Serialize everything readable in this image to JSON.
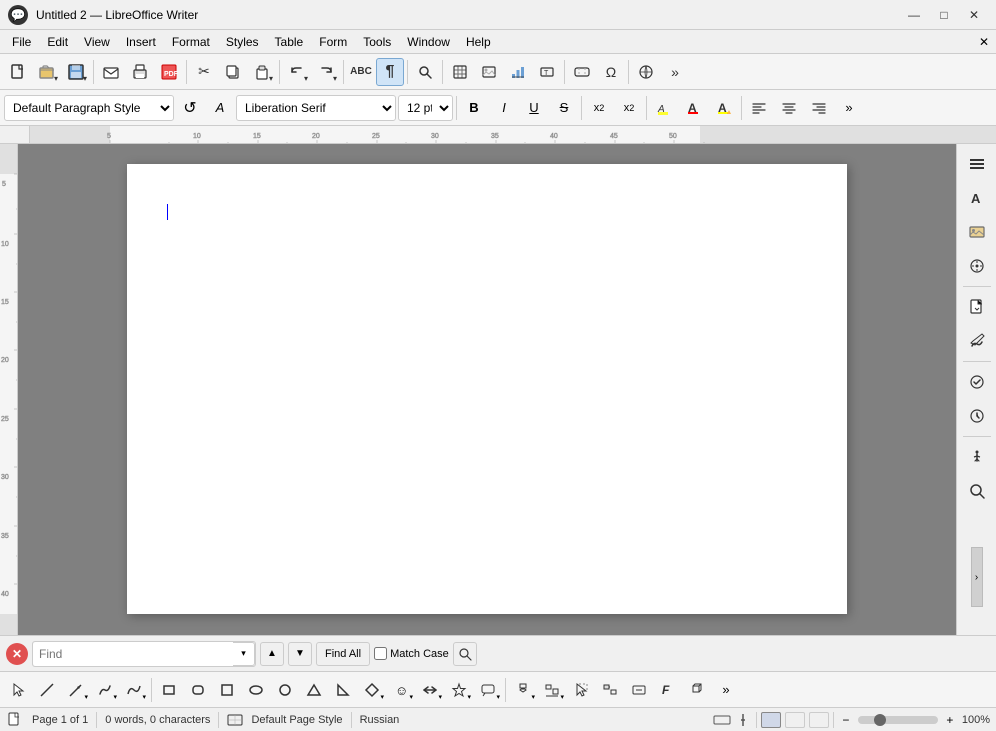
{
  "titlebar": {
    "title": "Untitled 2 — LibreOffice Writer",
    "icon": "💬",
    "minimize": "—",
    "maximize": "□",
    "close": "✕"
  },
  "menubar": {
    "items": [
      "File",
      "Edit",
      "View",
      "Insert",
      "Format",
      "Styles",
      "Table",
      "Form",
      "Tools",
      "Window",
      "Help"
    ],
    "close_icon": "✕"
  },
  "toolbar1": {
    "buttons": [
      {
        "name": "new-btn",
        "icon": "📄",
        "label": "New"
      },
      {
        "name": "open-btn",
        "icon": "📂",
        "label": "Open"
      },
      {
        "name": "save-btn",
        "icon": "💾",
        "label": "Save"
      },
      {
        "name": "print-btn",
        "icon": "🖨",
        "label": "Print"
      },
      {
        "name": "pdf-btn",
        "icon": "📑",
        "label": "Export PDF"
      },
      {
        "name": "cut-btn",
        "icon": "✂",
        "label": "Cut"
      },
      {
        "name": "copy-btn",
        "icon": "📋",
        "label": "Copy"
      },
      {
        "name": "paste-btn",
        "icon": "📌",
        "label": "Paste"
      },
      {
        "name": "undo-btn",
        "icon": "↩",
        "label": "Undo"
      },
      {
        "name": "redo-btn",
        "icon": "↪",
        "label": "Redo"
      },
      {
        "name": "spellcheck-btn",
        "icon": "ABC",
        "label": "Spellcheck"
      },
      {
        "name": "nonprint-btn",
        "icon": "¶",
        "label": "Non-printing"
      },
      {
        "name": "table-btn",
        "icon": "⊞",
        "label": "Insert Table"
      },
      {
        "name": "image-btn",
        "icon": "🖼",
        "label": "Insert Image"
      },
      {
        "name": "chart-btn",
        "icon": "📊",
        "label": "Insert Chart"
      },
      {
        "name": "textbox-btn",
        "icon": "T",
        "label": "Insert Textbox"
      },
      {
        "name": "field-btn",
        "icon": "⊡",
        "label": "Insert Field"
      },
      {
        "name": "special-char-btn",
        "icon": "Ω",
        "label": "Special Character"
      },
      {
        "name": "web-btn",
        "icon": "🌐",
        "label": "Web Browser"
      },
      {
        "name": "more-btn",
        "icon": "»",
        "label": "More"
      }
    ]
  },
  "fmt_toolbar": {
    "style_placeholder": "Default Paragraph Style",
    "font_placeholder": "Liberation Serif",
    "size_value": "12 pt",
    "bold": "B",
    "italic": "I",
    "underline": "U",
    "strikethrough": "S",
    "superscript": "x²",
    "subscript": "x₂",
    "highlight": "🖊",
    "font_color": "A",
    "bg_color": "A",
    "align_left": "≡",
    "align_center": "≡",
    "align_right": "≡",
    "more": "»"
  },
  "find_bar": {
    "placeholder": "Find",
    "find_all": "Find All",
    "match_case": "Match Case"
  },
  "statusbar": {
    "page": "Page 1 of 1",
    "words": "0 words, 0 characters",
    "page_style": "Default Page Style",
    "language": "Russian",
    "zoom": "100%"
  },
  "right_panel": {
    "buttons": [
      {
        "name": "properties-panel-btn",
        "icon": "≡"
      },
      {
        "name": "styles-panel-btn",
        "icon": "A"
      },
      {
        "name": "gallery-panel-btn",
        "icon": "🖼"
      },
      {
        "name": "navigator-panel-btn",
        "icon": "⊕"
      },
      {
        "name": "new-doc-panel-btn",
        "icon": "📄"
      },
      {
        "name": "signatures-panel-btn",
        "icon": "✏"
      },
      {
        "name": "track-changes-panel-btn",
        "icon": "👁"
      },
      {
        "name": "versions-panel-btn",
        "icon": "🕐"
      },
      {
        "name": "accessibility-panel-btn",
        "icon": "♿"
      },
      {
        "name": "search-panel-btn",
        "icon": "🔍"
      }
    ]
  }
}
